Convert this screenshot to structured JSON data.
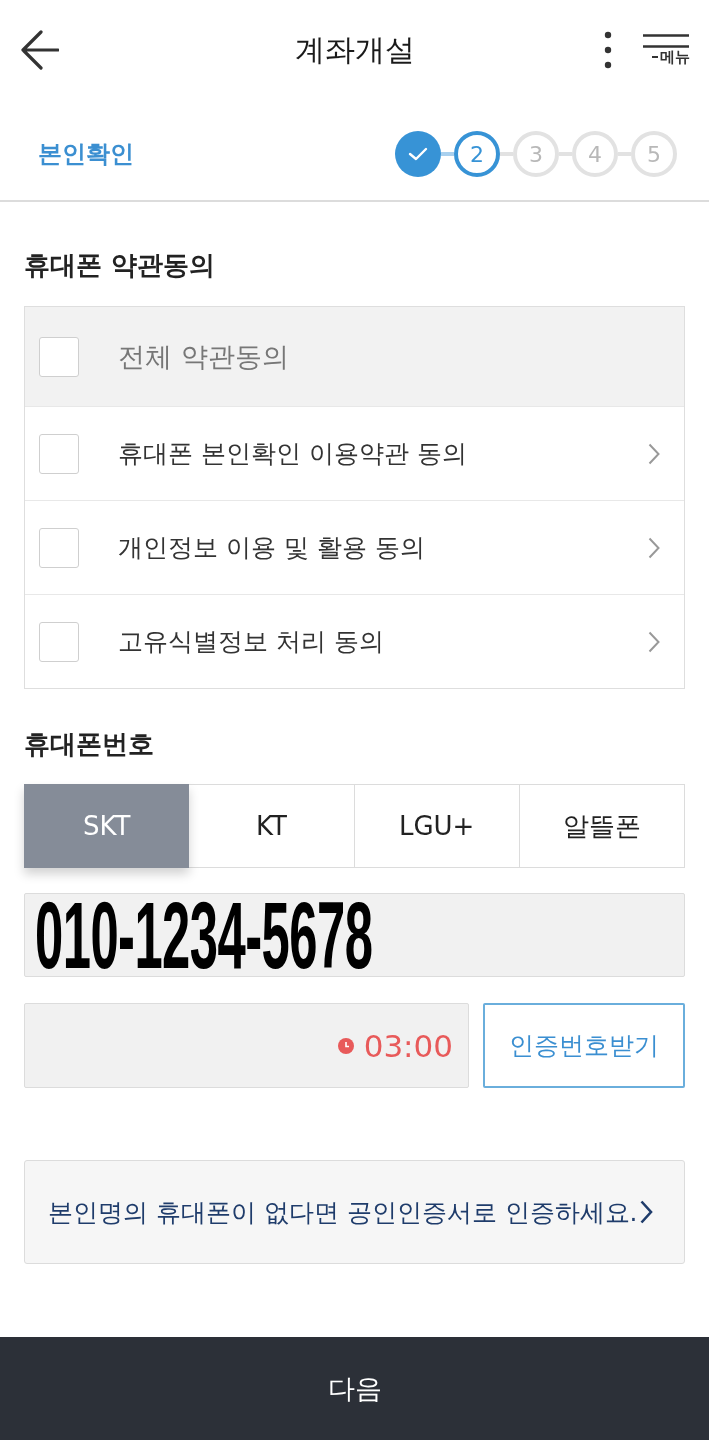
{
  "header": {
    "title": "계좌개설",
    "menu_label": "메뉴"
  },
  "progress": {
    "label": "본인확인",
    "steps": [
      {
        "done": true,
        "selected": false
      },
      {
        "label": "2",
        "done": false,
        "selected": true
      },
      {
        "label": "3",
        "done": false,
        "selected": false
      },
      {
        "label": "4",
        "done": false,
        "selected": false
      },
      {
        "label": "5",
        "done": false,
        "selected": false
      }
    ]
  },
  "terms": {
    "title": "휴대폰 약관동의",
    "items": [
      {
        "kind": "all",
        "label": "전체 약관동의",
        "checked": false
      },
      {
        "kind": "item",
        "label": "휴대폰 본인확인 이용약관 동의",
        "checked": false
      },
      {
        "kind": "item",
        "label": "개인정보 이용 및 활용 동의",
        "checked": false
      },
      {
        "kind": "item",
        "label": "고유식별정보 처리 동의",
        "checked": false
      }
    ]
  },
  "phone": {
    "title": "휴대폰번호",
    "carriers": [
      {
        "label": "SKT",
        "selected": true
      },
      {
        "label": "KT",
        "selected": false
      },
      {
        "label": "LGU+",
        "selected": false
      },
      {
        "label": "알뜰폰",
        "selected": false
      }
    ],
    "number": {
      "value": "010-1234-5678"
    },
    "code": {
      "timer": "03:00",
      "button": "인증번호받기"
    }
  },
  "notice": "본인명의 휴대폰이 없다면 공인인증서로 인증하세요.",
  "next_button": "다음"
}
